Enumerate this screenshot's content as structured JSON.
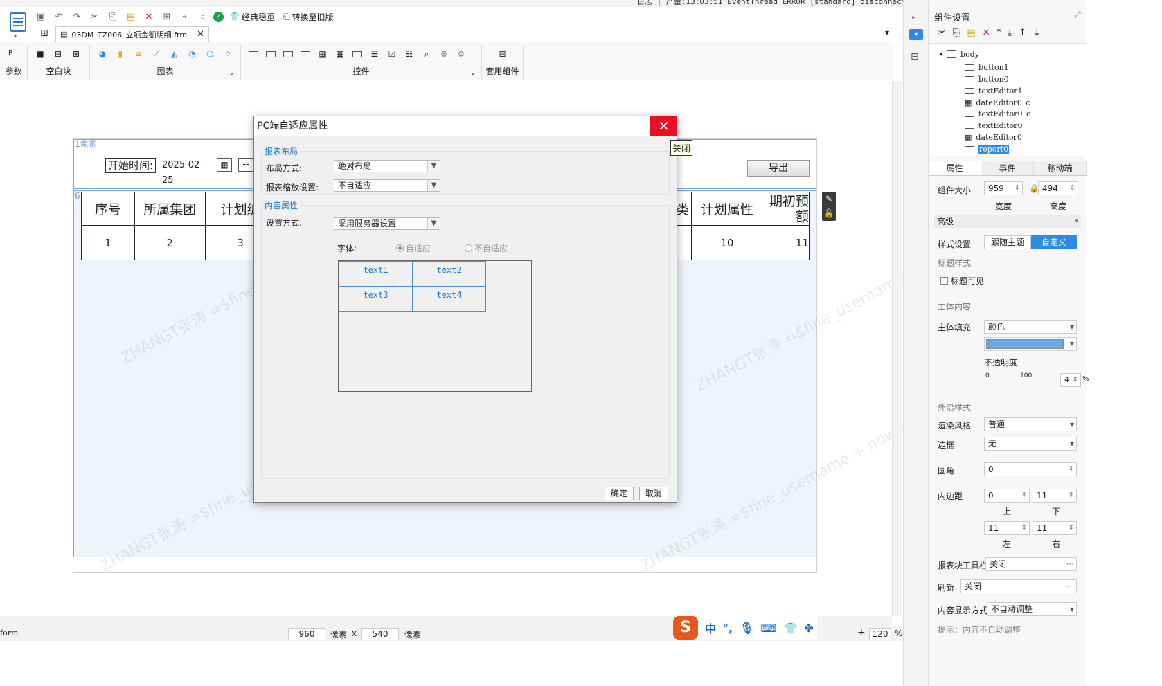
{
  "log_line": "日志 | 产量:13:03:51 EventThread ERROR [standard] disconnected args: transport error",
  "toolbar": {
    "classic_steady": "经典稳重",
    "convert_old": "转换至旧版"
  },
  "doc_tab": {
    "title": "03DM_TZ006_立项金额明细.frm"
  },
  "ribbon": {
    "params": "参数",
    "blank_block": "空白块",
    "chart": "图表",
    "controls": "控件",
    "kit_component": "套用组件"
  },
  "canvas": {
    "panel1_label": "1像素",
    "panel2_label": "6 像素",
    "start_time_label": "开始时间:",
    "start_date": "2025-02-25",
    "dash": "--",
    "export_button": "导出",
    "headers": [
      "序号",
      "所属集团",
      "计划编",
      "类",
      "计划属性",
      "期初预"
    ],
    "header_last_sub": "额",
    "row_values": [
      "1",
      "2",
      "3",
      "",
      "10",
      "11"
    ]
  },
  "status_bar": {
    "left": "form",
    "width": "960",
    "px1": "像素",
    "x": "x",
    "height": "540",
    "px2": "像素",
    "zoom": "120",
    "pct": "%"
  },
  "ime": {
    "lang": "中",
    "punct": "°,"
  },
  "right_panel": {
    "title": "组件设置",
    "tree": {
      "root": "body",
      "items": [
        "button1",
        "button0",
        "textEditor1",
        "dateEditor0_c",
        "textEditor0_c",
        "textEditor0",
        "dateEditor0",
        "report0"
      ]
    },
    "tabs": [
      "属性",
      "事件",
      "移动端"
    ],
    "size_label": "组件大小",
    "width_value": "959",
    "height_value": "494",
    "width_caption": "宽度",
    "height_caption": "高度",
    "advanced": "高级",
    "style_setting": "样式设置",
    "follow_theme": "跟随主题",
    "custom": "自定义",
    "title_style": "标题样式",
    "title_visible": "标题可见",
    "body_content": "主体内容",
    "body_fill": "主体填充",
    "fill_type": "颜色",
    "fill_color": "#6aa9e3",
    "opacity": "不透明度",
    "opacity_min": "0",
    "opacity_max": "100",
    "opacity_value": "4",
    "opacity_pct": "%",
    "outer_style": "外沿样式",
    "render_style": "渲染风格",
    "render_value": "普通",
    "border": "边框",
    "border_value": "无",
    "radius": "圆角",
    "radius_value": "0",
    "padding": "内边距",
    "pad_top": "0",
    "pad_bottom": "11",
    "pad_left": "11",
    "pad_right": "11",
    "top": "上",
    "bottom": "下",
    "left": "左",
    "right": "右",
    "toolbar_label": "报表块工具栏",
    "toolbar_value": "关闭",
    "refresh_label": "刷新",
    "refresh_value": "关闭",
    "display_label": "内容显示方式",
    "display_value": "不自动调整",
    "hint": "提示：内容不自动调整"
  },
  "dialog": {
    "title": "PC端自适应属性",
    "close_tooltip": "关闭",
    "layout_group": "报表布局",
    "layout_mode_label": "布局方式:",
    "layout_mode_value": "绝对布局",
    "scale_label": "报表缩放设置:",
    "scale_value": "不自适应",
    "content_group": "内容属性",
    "set_mode_label": "设置方式:",
    "set_mode_value": "采用服务器设置",
    "font_label": "字体:",
    "adaptive": "自适应",
    "not_adaptive": "不自适应",
    "cells": [
      "text1",
      "text2",
      "text3",
      "text4"
    ],
    "ok": "确定",
    "cancel": "取消"
  },
  "watermark": "ZHANGT张涛 =$fine_username + now()"
}
